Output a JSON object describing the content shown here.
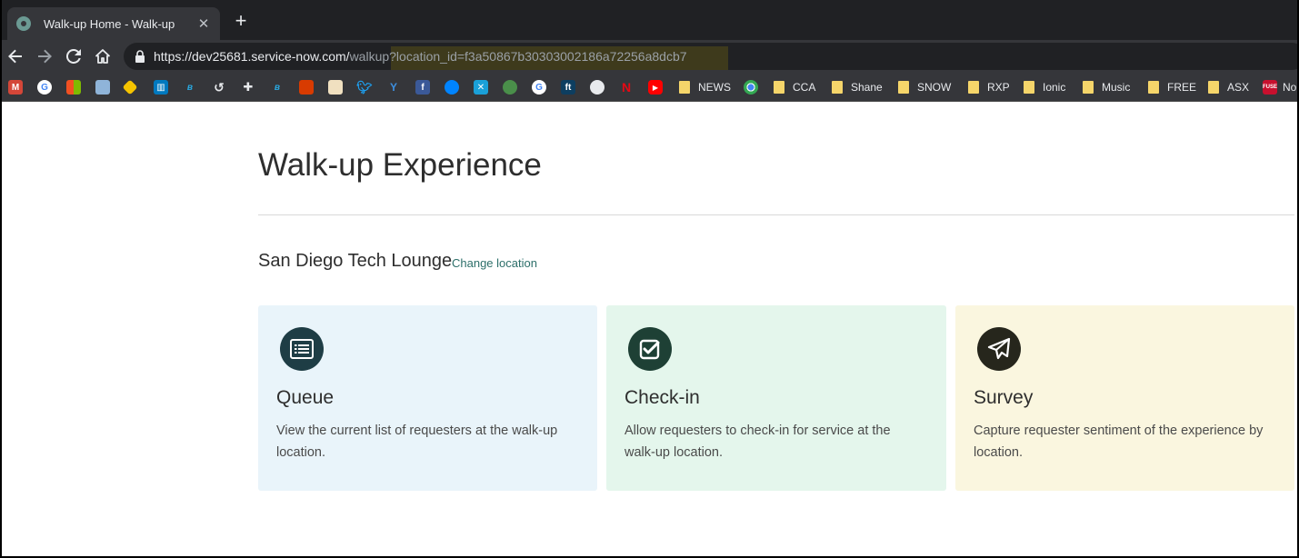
{
  "browser": {
    "tab_title": "Walk-up Home - Walk-up",
    "new_tab": "+",
    "tab_close": "✕",
    "url_host": "https://dev25681.service-now.com/",
    "url_path": "walkup?location_id=f3a50867b30303002186a72256a8dcb7",
    "bookmarks": [
      "NEWS",
      "CCA",
      "Shane",
      "SNOW",
      "RXP",
      "Ionic",
      "Music",
      "FREE",
      "ASX",
      "No"
    ]
  },
  "page": {
    "title": "Walk-up Experience",
    "location_name": "San Diego Tech Lounge",
    "change_location": "Change location"
  },
  "cards": [
    {
      "title": "Queue",
      "description": "View the current list of requesters at the walk-up location.",
      "icon": "list-icon",
      "bg": "#e9f4fa",
      "icon_bg": "#1e3d45"
    },
    {
      "title": "Check-in",
      "description": "Allow requesters to check-in for service at the walk-up location.",
      "icon": "checkbox-icon",
      "bg": "#e4f6ec",
      "icon_bg": "#1e4035"
    },
    {
      "title": "Survey",
      "description": "Capture requester sentiment of the experience by location.",
      "icon": "paper-plane-icon",
      "bg": "#faf6df",
      "icon_bg": "#26261c"
    }
  ]
}
